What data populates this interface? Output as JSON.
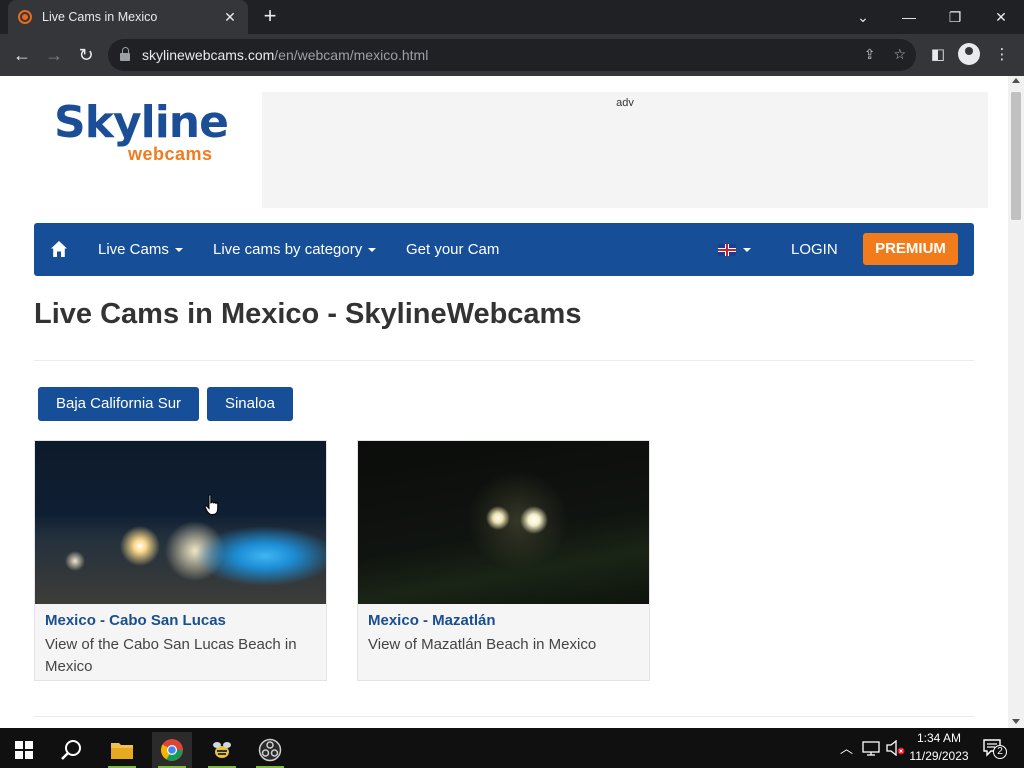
{
  "browser": {
    "tab_title": "Live Cams in Mexico",
    "url_host": "skylinewebcams.com",
    "url_path": "/en/webcam/mexico.html"
  },
  "site": {
    "logo_main": "Skyline",
    "logo_sub": "webcams",
    "adv_label": "adv"
  },
  "nav": {
    "items": [
      {
        "label": "Live Cams",
        "dropdown": true
      },
      {
        "label": "Live cams by category",
        "dropdown": true
      },
      {
        "label": "Get your Cam",
        "dropdown": false
      }
    ],
    "language_icon": "uk-flag-icon",
    "login_label": "LOGIN",
    "premium_label": "PREMIUM"
  },
  "page": {
    "heading": "Live Cams in Mexico - SkylineWebcams",
    "regions": [
      "Baja California Sur",
      "Sinaloa"
    ],
    "cams": [
      {
        "title": "Mexico - Cabo San Lucas",
        "description": "View of the Cabo San Lucas Beach in Mexico"
      },
      {
        "title": "Mexico - Mazatlán",
        "description": "View of Mazatlán Beach in Mexico"
      }
    ]
  },
  "taskbar": {
    "time": "1:34 AM",
    "date": "11/29/2023",
    "notification_count": "2"
  },
  "colors": {
    "brand_blue": "#164f98",
    "brand_orange": "#f27b1c"
  }
}
